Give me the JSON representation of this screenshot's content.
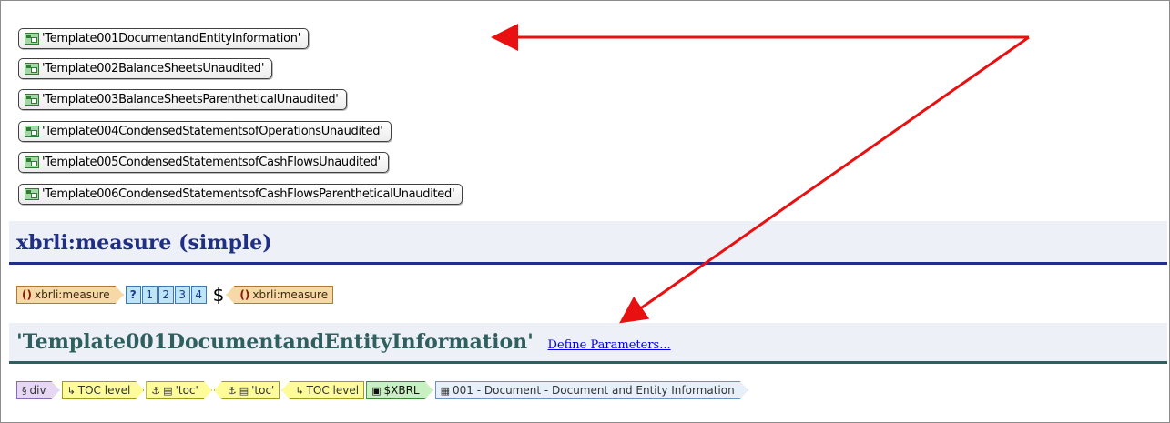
{
  "templates": [
    "'Template001DocumentandEntityInformation'",
    "'Template002BalanceSheetsUnaudited'",
    "'Template003BalanceSheetsParentheticalUnaudited'",
    "'Template004CondensedStatementsofOperationsUnaudited'",
    "'Template005CondensedStatementsofCashFlowsUnaudited'",
    "'Template006CondensedStatementsofCashFlowsParentheticalUnaudited'"
  ],
  "heading1": "xbrli:measure (simple)",
  "measure_row": {
    "open_label": "xbrli:measure",
    "predicates": [
      "?",
      "1",
      "2",
      "3",
      "4"
    ],
    "content": "$",
    "close_label": "xbrli:measure"
  },
  "heading2": {
    "title": "'Template001DocumentandEntityInformation'",
    "link": "Define Parameters..."
  },
  "toc_row": {
    "div": "div",
    "toc_level_open": "TOC level",
    "toc_open": "'toc'",
    "toc_close": "'toc'",
    "toc_level_close": "TOC level",
    "xbrl": "$XBRL",
    "document": "001 - Document - Document and Entity Information"
  },
  "colors": {
    "arrow": "#e81010",
    "heading_blue": "#1f2f86",
    "heading_teal": "#2f5f5f"
  }
}
